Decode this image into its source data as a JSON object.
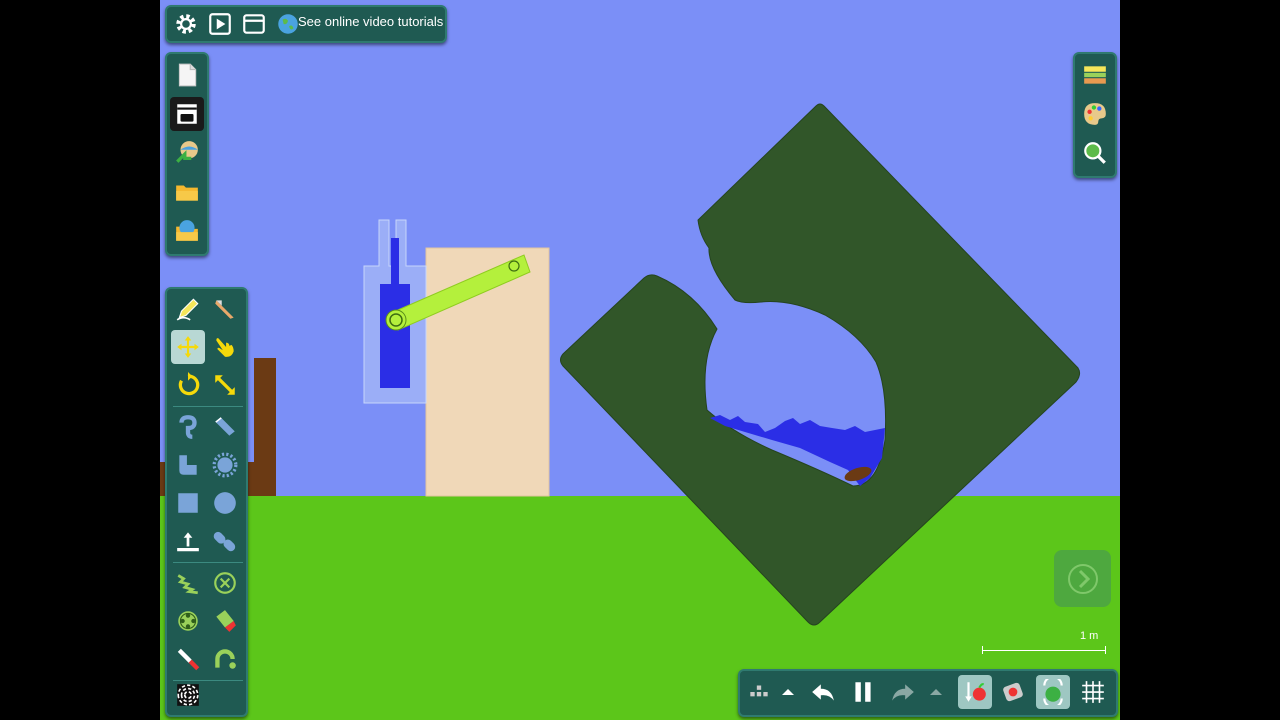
{
  "topbar": {
    "tutorials_label": "See online video tutorials",
    "icons": [
      "gear-icon",
      "play-icon",
      "window-icon",
      "globe-icon"
    ]
  },
  "file_panel": {
    "icons": [
      "new-scene-icon",
      "scene-properties-icon",
      "download-scene-icon",
      "open-folder-icon",
      "online-scenes-icon"
    ]
  },
  "view_panel": {
    "icons": [
      "layers-icon",
      "palette-icon",
      "zoom-icon"
    ]
  },
  "tools_panel": {
    "icons": [
      "sketch-tool-icon",
      "cut-tool-icon",
      "move-tool-icon",
      "drag-tool-icon",
      "rotate-tool-icon",
      "scale-tool-icon",
      "hook-tool-icon",
      "brush-tool-icon",
      "polygon-tool-icon",
      "gear-shape-icon",
      "box-tool-icon",
      "circle-tool-icon",
      "plane-tool-icon",
      "chain-tool-icon",
      "spring-tool-icon",
      "fixate-tool-icon",
      "hinge-tool-icon",
      "thruster-tool-icon",
      "laser-tool-icon",
      "tracer-tool-icon",
      "texture-tool-icon"
    ],
    "active": "move-tool-icon"
  },
  "playback": {
    "icons": [
      "grid-menu-icon",
      "undo-up-icon",
      "undo-icon",
      "pause-icon",
      "redo-icon",
      "redo-up-icon",
      "gravity-icon",
      "air-friction-icon",
      "controller-icon",
      "grid-icon"
    ]
  },
  "scale": {
    "label": "1 m"
  },
  "colors": {
    "sky": "#7b8ff7",
    "ground": "#5cc61a",
    "panel": "#1f5a52",
    "block": "#315629",
    "water": "#2b2ee6",
    "rod": "#b4f03c",
    "beige": "#f0d8b8",
    "brown": "#6b3a14"
  }
}
